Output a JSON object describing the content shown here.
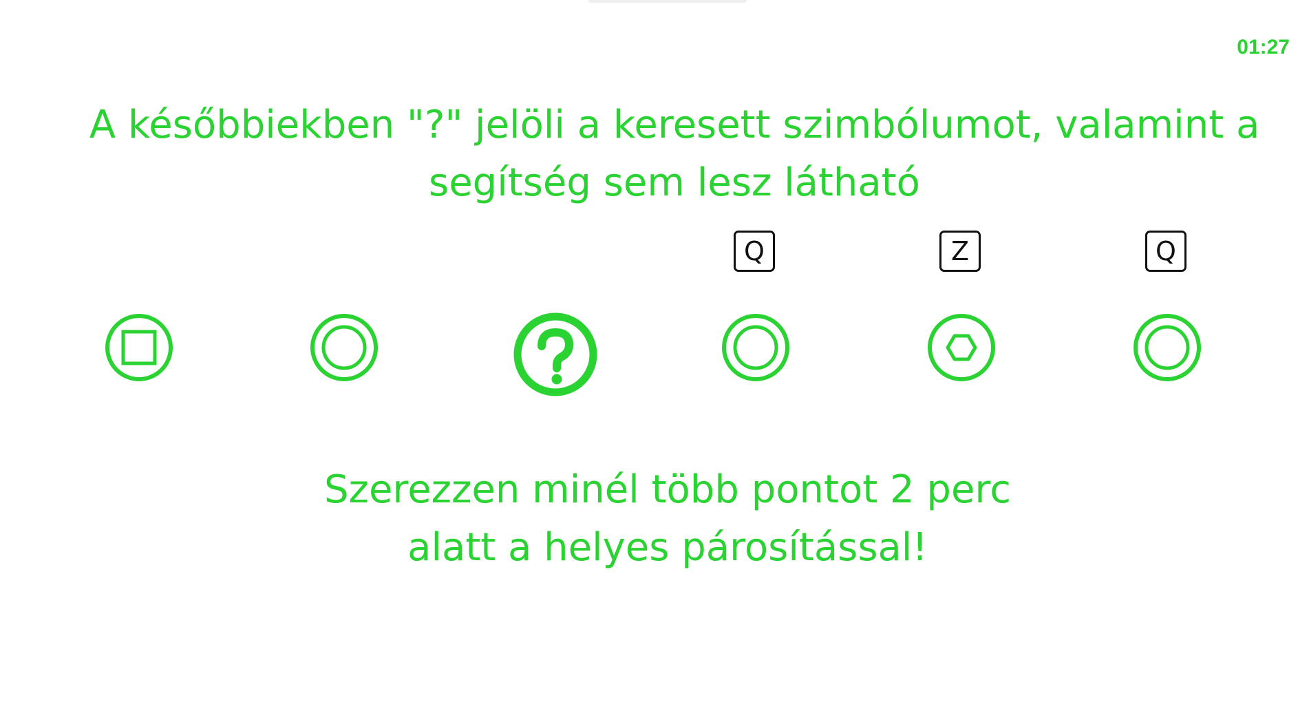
{
  "timer": {
    "text": "01:27"
  },
  "instructions": {
    "top": "A későbbiekben \"?\" jelöli a keresett szimbólumot, valamint a segítség sem lesz látható",
    "bottom_line1": "Szerezzen minél több pontot 2 perc",
    "bottom_line2": "alatt a helyes párosítással!"
  },
  "sequence": [
    {
      "symbol": "square-in-circle-icon",
      "key": ""
    },
    {
      "symbol": "circle-in-circle-icon",
      "key": ""
    },
    {
      "symbol": "question-mark-icon",
      "key": ""
    },
    {
      "symbol": "circle-in-circle-icon",
      "key": "Q"
    },
    {
      "symbol": "hexagon-in-circle-icon",
      "key": "Z"
    },
    {
      "symbol": "circle-in-circle-icon",
      "key": "Q"
    }
  ],
  "colors": {
    "accent": "#2ad232",
    "key_border": "#111111",
    "background": "#ffffff"
  }
}
